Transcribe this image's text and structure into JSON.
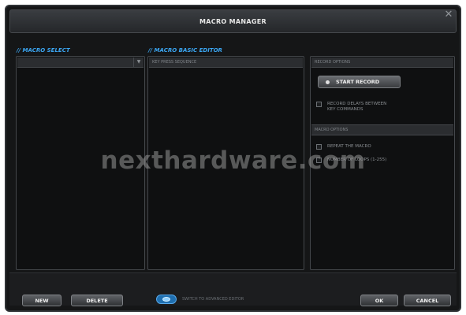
{
  "window": {
    "title": "MACRO MANAGER",
    "close_glyph": "✕"
  },
  "macro_select": {
    "header": "// MACRO SELECT",
    "dropdown_value": "",
    "dropdown_arrow": "▼"
  },
  "basic_editor": {
    "header": "// MACRO BASIC EDITOR",
    "sequence_header": "KEY PRESS SEQUENCE"
  },
  "record_options": {
    "header": "RECORD OPTIONS",
    "start_record_label": "START RECORD",
    "record_delays_label": "RECORD DELAYS BETWEEN\nKEY COMMANDS"
  },
  "macro_options": {
    "header": "MACRO OPTIONS",
    "repeat_label": "REPEAT THE MACRO",
    "loops_label": "NUMBER OF LOOPS (1-255)"
  },
  "bottom": {
    "new_label": "NEW",
    "delete_label": "DELETE",
    "switch_label": "SWITCH TO ADVANCED EDITOR",
    "ok_label": "OK",
    "cancel_label": "CANCEL"
  },
  "watermark": "nexthardware.com",
  "colors": {
    "accent": "#3ba6f2",
    "background": "#151617",
    "panel_border": "#44474b"
  }
}
